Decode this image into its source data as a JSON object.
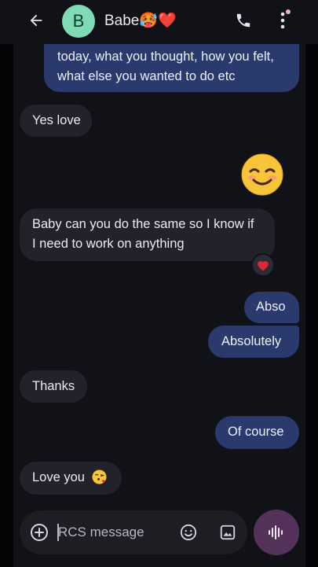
{
  "header": {
    "avatar_letter": "B",
    "contact_name": "Babe🥵❤️"
  },
  "messages": [
    {
      "direction": "outgoing",
      "text": "today, what you thought, how you felt,",
      "text2": "what else you wanted to do etc"
    },
    {
      "direction": "incoming",
      "text": "Yes love"
    },
    {
      "direction": "outgoing",
      "text": "😊"
    },
    {
      "direction": "incoming",
      "text": "Baby can you do the same so I know if",
      "text2": "I need to work on anything",
      "reaction": "❤️"
    },
    {
      "direction": "outgoing",
      "text": "Abso"
    },
    {
      "direction": "outgoing",
      "text": "Absolutely"
    },
    {
      "direction": "incoming",
      "text": "Thanks"
    },
    {
      "direction": "outgoing",
      "text": "Of course"
    },
    {
      "direction": "incoming",
      "text": "Love you",
      "emoji": "😘"
    }
  ],
  "composer": {
    "placeholder": "RCS message"
  },
  "colors": {
    "outgoing_bubble": "#2a3a6c",
    "incoming_bubble": "#22232a",
    "avatar": "#7fdbb6",
    "voice_button": "#55325a",
    "background": "#111217"
  },
  "icons": [
    "back-arrow-icon",
    "phone-icon",
    "more-vert-icon",
    "add-circle-icon",
    "emoji-icon",
    "gallery-icon",
    "voice-waveform-icon",
    "heart-icon"
  ]
}
